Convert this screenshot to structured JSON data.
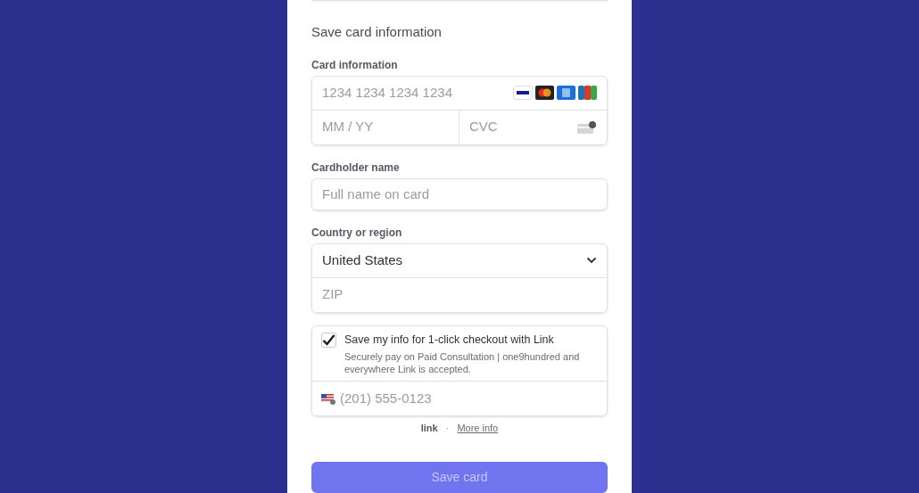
{
  "heading": "Save card information",
  "card": {
    "label": "Card information",
    "number_placeholder": "1234 1234 1234 1234",
    "expiry_placeholder": "MM / YY",
    "cvc_placeholder": "CVC"
  },
  "cardholder": {
    "label": "Cardholder name",
    "placeholder": "Full name on card"
  },
  "country": {
    "label": "Country or region",
    "value": "United States",
    "zip_placeholder": "ZIP"
  },
  "link_opt_in": {
    "checked": true,
    "title": "Save my info for 1-click checkout with Link",
    "description": "Securely pay on Paid Consultation | one9hundred and everywhere Link is accepted.",
    "phone_placeholder": "(201) 555-0123"
  },
  "link_footer": {
    "brand": "link",
    "separator": "·",
    "more_info": "More info"
  },
  "submit": {
    "label": "Save card",
    "disabled": true
  }
}
